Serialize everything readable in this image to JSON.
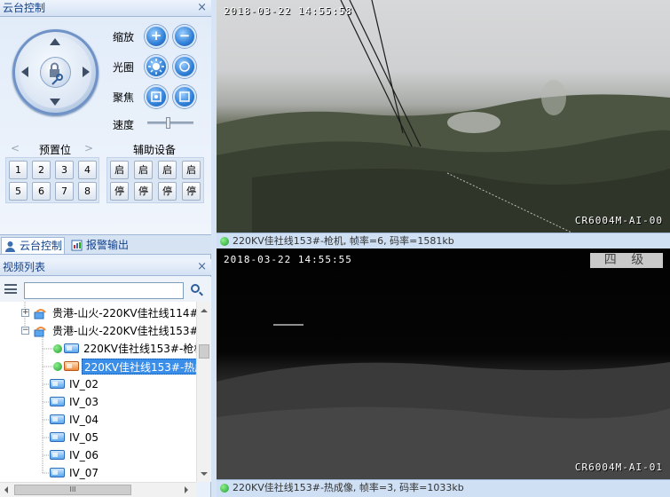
{
  "ptz_panel": {
    "title": "云台控制",
    "close_label": "×",
    "zoom_label": "缩放",
    "iris_label": "光圈",
    "focus_label": "聚焦",
    "speed_label": "速度",
    "speed_level": 0.45,
    "preset_label": "预置位",
    "preset_prev": "<",
    "preset_next": ">",
    "aux_label": "辅助设备",
    "presets": [
      "1",
      "2",
      "3",
      "4",
      "5",
      "6",
      "7",
      "8"
    ],
    "aux_on": [
      "启",
      "启",
      "启",
      "启"
    ],
    "aux_off": [
      "停",
      "停",
      "停",
      "停"
    ],
    "zoom_in": "+",
    "zoom_out": "−"
  },
  "tabs": [
    {
      "label": "云台控制",
      "active": true
    },
    {
      "label": "报警输出",
      "active": false
    }
  ],
  "video_list": {
    "title": "视频列表",
    "close_label": "×",
    "search_value": "",
    "items": [
      {
        "label": "贵港-山火-220KV佳社线114#",
        "type": "group",
        "expander": "+"
      },
      {
        "label": "贵港-山火-220KV佳社线153#",
        "type": "group",
        "expander": "−"
      },
      {
        "label": "220KV佳社线153#-枪机",
        "type": "camera",
        "online": true,
        "camera": "blue"
      },
      {
        "label": "220KV佳社线153#-热成",
        "type": "camera",
        "online": true,
        "camera": "orange",
        "selected": true
      },
      {
        "label": "IV_02",
        "type": "camera",
        "camera": "blue"
      },
      {
        "label": "IV_03",
        "type": "camera",
        "camera": "blue"
      },
      {
        "label": "IV_04",
        "type": "camera",
        "camera": "blue"
      },
      {
        "label": "IV_05",
        "type": "camera",
        "camera": "blue"
      },
      {
        "label": "IV_06",
        "type": "camera",
        "camera": "blue"
      },
      {
        "label": "IV_07",
        "type": "camera",
        "camera": "blue"
      }
    ],
    "hscroll_grip": "III"
  },
  "video1": {
    "timestamp": "2018-03-22 14:55:58",
    "device": "CR6004M-AI-00",
    "status": "220KV佳社线153#-枪机, 帧率=6, 码率=1581kb"
  },
  "video2": {
    "timestamp": "2018-03-22 14:55:55",
    "device": "CR6004M-AI-01",
    "grade": "四 级",
    "status": "220KV佳社线153#-热成像, 帧率=3, 码率=1033kb"
  },
  "colors": {
    "accent": "#15428b",
    "online": "#1e9e2e",
    "selected": "#3b8ee8"
  }
}
